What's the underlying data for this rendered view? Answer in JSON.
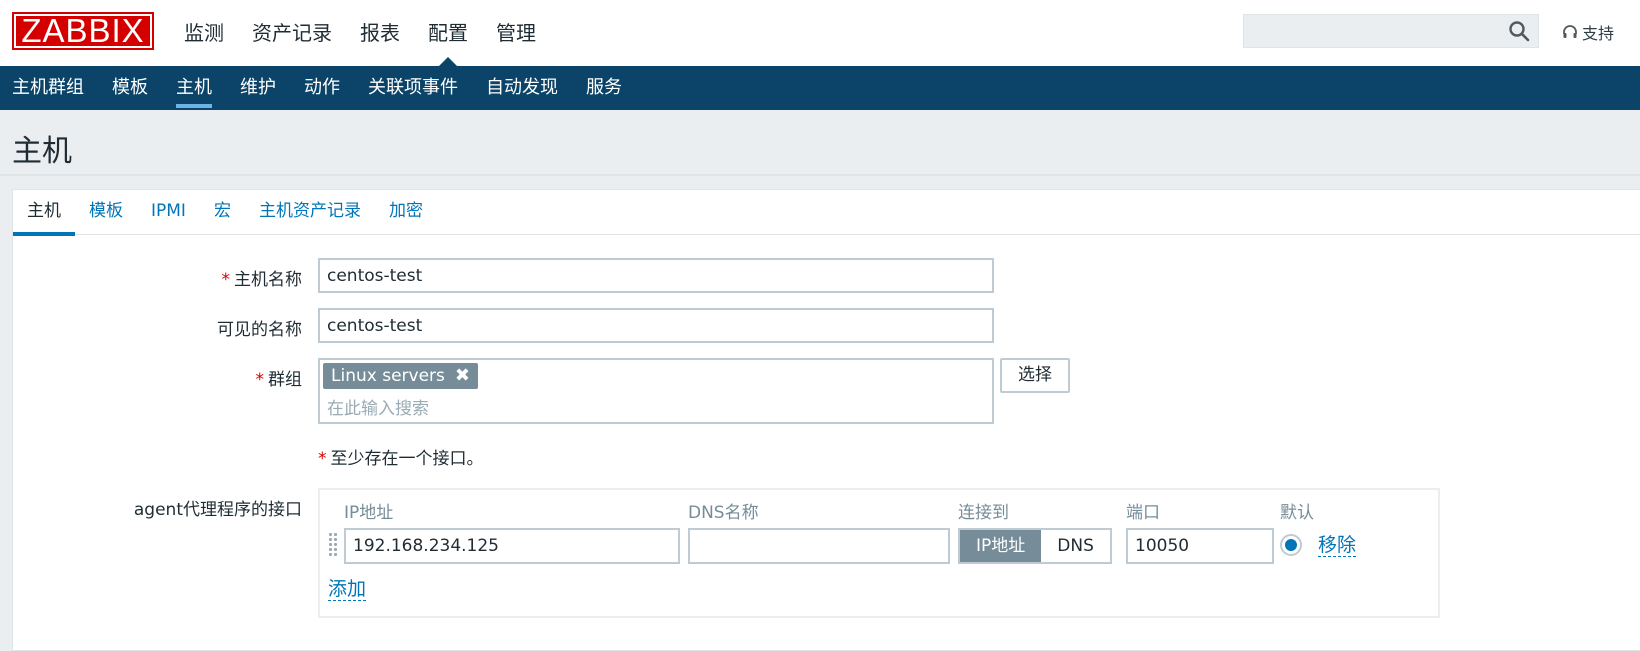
{
  "logo": "ZABBIX",
  "main_nav": [
    "监测",
    "资产记录",
    "报表",
    "配置",
    "管理"
  ],
  "search": {
    "value": "",
    "icon": "search-icon"
  },
  "support": {
    "label": "支持",
    "icon": "headset-icon"
  },
  "sub_nav": [
    "主机群组",
    "模板",
    "主机",
    "维护",
    "动作",
    "关联项事件",
    "自动发现",
    "服务"
  ],
  "page_title": "主机",
  "tabs": [
    "主机",
    "模板",
    "IPMI",
    "宏",
    "主机资产记录",
    "加密"
  ],
  "form": {
    "host_name": {
      "label": "主机名称",
      "required": "*",
      "value": "centos-test"
    },
    "visible_name": {
      "label": "可见的名称",
      "value": "centos-test"
    },
    "groups": {
      "label": "群组",
      "required": "*",
      "chip": "Linux servers",
      "placeholder": "在此输入搜索",
      "select_button": "选择"
    },
    "interface_note": {
      "required": "*",
      "text": "至少存在一个接口。"
    },
    "agent_interfaces": {
      "label": "agent代理程序的接口",
      "columns": {
        "ip": "IP地址",
        "dns": "DNS名称",
        "connect_to": "连接到",
        "port": "端口",
        "default": "默认"
      },
      "row": {
        "ip": "192.168.234.125",
        "dns": "",
        "connect_ip": "IP地址",
        "connect_dns": "DNS",
        "port": "10050",
        "remove": "移除"
      },
      "add": "添加"
    }
  },
  "colors": {
    "accent": "#0275b8",
    "nav_bg": "#0b4468",
    "logo_red": "#d40000"
  }
}
